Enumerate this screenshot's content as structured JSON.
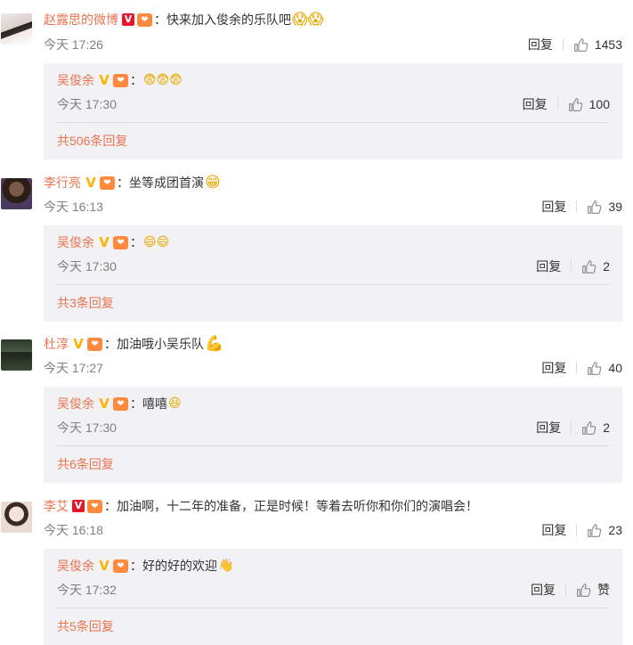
{
  "comments": [
    {
      "author": "赵露思的微博",
      "badge": "V",
      "level": "❤",
      "text": "：快来加入俊余的乐队吧",
      "emoji": "😱😱",
      "time": "今天 17:26",
      "reply_label": "回复",
      "likes": "1453",
      "reply": {
        "author": "吴俊余",
        "badge": "V",
        "level": "❤",
        "text": "：",
        "emoji": "😨😨😨",
        "time": "今天 17:30",
        "reply_label": "回复",
        "likes": "100",
        "more": "共506条回复"
      }
    },
    {
      "author": "李行亮",
      "badge": "V",
      "level": "❤",
      "text": "：坐等成团首演",
      "emoji": "😁",
      "time": "今天 16:13",
      "reply_label": "回复",
      "likes": "39",
      "reply": {
        "author": "吴俊余",
        "badge": "V",
        "level": "❤",
        "text": "：",
        "emoji": "😄😄",
        "time": "今天 17:30",
        "reply_label": "回复",
        "likes": "2",
        "more": "共3条回复"
      }
    },
    {
      "author": "杜淳",
      "badge": "V",
      "level": "❤",
      "text": "：加油哦小吴乐队",
      "emoji": "💪",
      "time": "今天 17:27",
      "reply_label": "回复",
      "likes": "40",
      "reply": {
        "author": "吴俊余",
        "badge": "V",
        "level": "❤",
        "text": "：嘻嘻",
        "emoji": "😆",
        "time": "今天 17:30",
        "reply_label": "回复",
        "likes": "2",
        "more": "共6条回复"
      }
    },
    {
      "author": "李艾",
      "badge": "V",
      "level": "❤",
      "text": "：加油啊，十二年的准备，正是时候！等着去听你和你们的演唱会！",
      "emoji": "",
      "time": "今天 16:18",
      "reply_label": "回复",
      "likes": "23",
      "reply": {
        "author": "吴俊余",
        "badge": "V",
        "level": "❤",
        "text": "：好的好的欢迎",
        "emoji": "👋",
        "time": "今天 17:32",
        "reply_label": "回复",
        "likes": "赞",
        "more": "共5条回复"
      }
    }
  ],
  "colors": {
    "name": "#eb7350",
    "reply_bg": "#f2f2f5",
    "time": "#808080",
    "badge_red": "#e6162d",
    "badge_gold": "#ffb300"
  },
  "icons": {
    "like": "thumb-up-icon",
    "verified": "verified-v-icon",
    "level": "fan-level-heart-icon"
  }
}
